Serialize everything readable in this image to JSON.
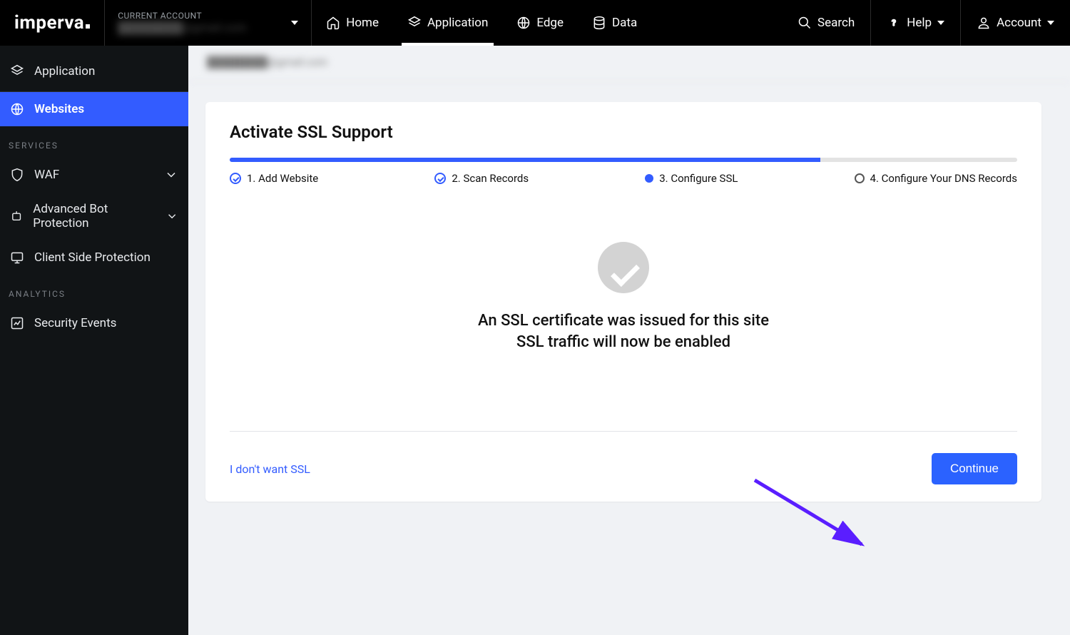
{
  "header": {
    "logo": "imperva",
    "account_label": "CURRENT ACCOUNT",
    "account_value": "████████@gmail.com",
    "nav": {
      "home": "Home",
      "application": "Application",
      "edge": "Edge",
      "data": "Data",
      "search": "Search",
      "help": "Help",
      "account": "Account"
    }
  },
  "sidebar": {
    "top": "Application",
    "websites": "Websites",
    "services_head": "SERVICES",
    "waf": "WAF",
    "bot": "Advanced Bot Protection",
    "csp": "Client Side Protection",
    "analytics_head": "ANALYTICS",
    "sec_events": "Security Events"
  },
  "breadcrumb": "████████@gmail.com",
  "card": {
    "title": "Activate SSL Support",
    "steps": {
      "s1": "1. Add Website",
      "s2": "2. Scan Records",
      "s3": "3. Configure SSL",
      "s4": "4. Configure Your DNS Records"
    },
    "msg1": "An SSL certificate was issued for this site",
    "msg2": "SSL traffic will now be enabled",
    "footer": {
      "skip": "I don't want SSL",
      "continue": "Continue"
    }
  }
}
